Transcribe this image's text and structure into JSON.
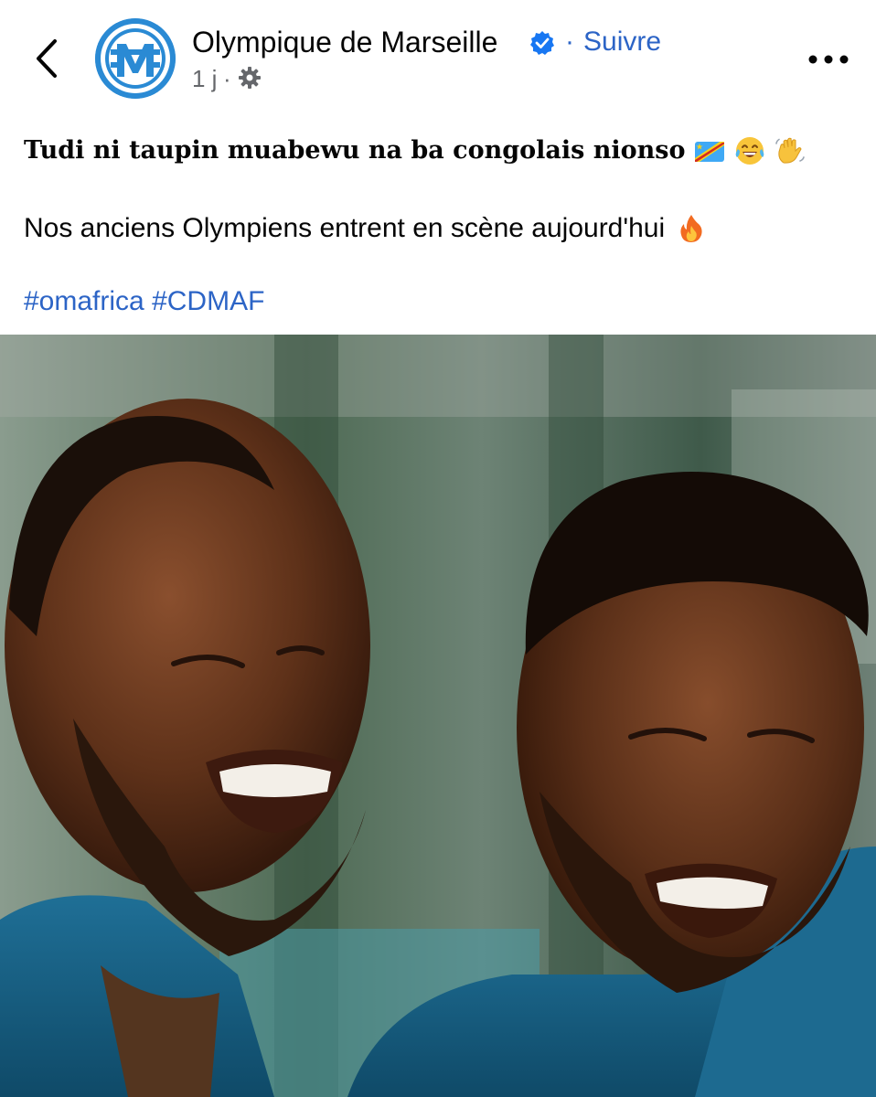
{
  "header": {
    "page_name": "Olympique de Marseille",
    "separator": "·",
    "follow_label": "Suivre",
    "timestamp": "1 j",
    "meta_separator": "·"
  },
  "post": {
    "line1": "Tudi ni taupin muabewu na ba congolais nionso",
    "line2": "Nos anciens Olympiens entrent en scène aujourd'hui",
    "hashtags": [
      "#omafrica",
      "#CDMAF"
    ]
  },
  "icons": {
    "back": "chevron-left-icon",
    "verified": "verified-badge-icon",
    "privacy": "gear-icon",
    "more": "more-horizontal-icon",
    "emojis_line1": [
      "drc-flag-emoji",
      "tears-of-joy-emoji",
      "waving-hand-emoji"
    ],
    "emojis_line2": [
      "fire-emoji"
    ]
  },
  "colors": {
    "link_blue": "#2c64c6",
    "secondary_text": "#65676b",
    "om_blue": "#2a8ad4"
  }
}
